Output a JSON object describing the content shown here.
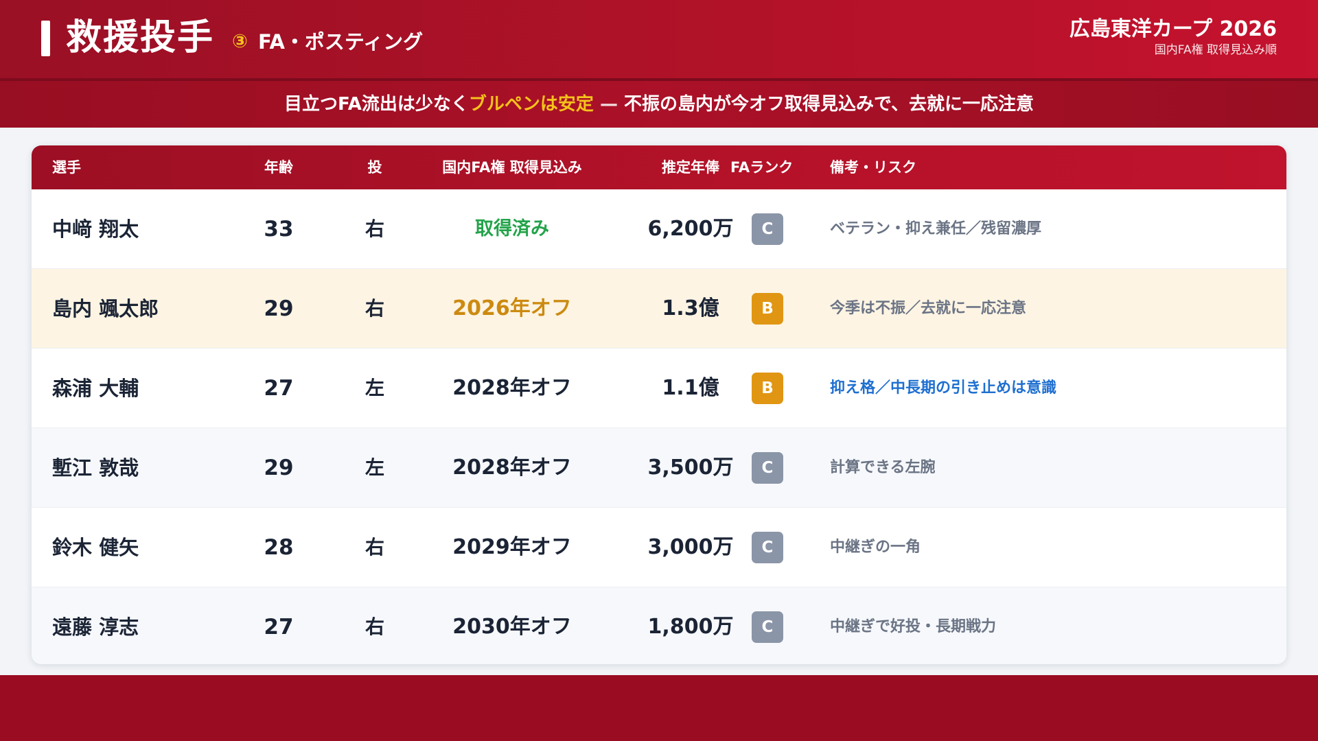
{
  "header": {
    "title": "救援投手",
    "number": "③",
    "subtitle": "FA・ポスティング",
    "team": "広島東洋カープ 2026",
    "team_sub": "国内FA権 取得見込み順"
  },
  "banner": {
    "part1": "目立つFA流出は少なく",
    "highlight": "ブルペンは安定",
    "dash": " — ",
    "part2": "不振の島内が今オフ取得見込みで、去就に一応注意"
  },
  "table": {
    "headers": {
      "player": "選手",
      "age": "年齢",
      "hand": "投",
      "fa": "国内FA権 取得見込み",
      "salary": "推定年俸",
      "rank": "FAランク",
      "notes": "備考・リスク"
    },
    "rows": [
      {
        "name": "中﨑 翔太",
        "age": "33",
        "hand": "右",
        "fa": "取得済み",
        "salary": "6,200万",
        "rank": "C",
        "notes": "ベテラン・抑え兼任／残留濃厚"
      },
      {
        "name": "島内 颯太郎",
        "age": "29",
        "hand": "右",
        "fa": "2026年オフ",
        "salary": "1.3億",
        "rank": "B",
        "notes": "今季は不振／去就に一応注意"
      },
      {
        "name": "森浦 大輔",
        "age": "27",
        "hand": "左",
        "fa": "2028年オフ",
        "salary": "1.1億",
        "rank": "B",
        "notes": "抑え格／中長期の引き止めは意識"
      },
      {
        "name": "塹江 敦哉",
        "age": "29",
        "hand": "左",
        "fa": "2028年オフ",
        "salary": "3,500万",
        "rank": "C",
        "notes": "計算できる左腕"
      },
      {
        "name": "鈴木 健矢",
        "age": "28",
        "hand": "右",
        "fa": "2029年オフ",
        "salary": "3,000万",
        "rank": "C",
        "notes": "中継ぎの一角"
      },
      {
        "name": "遠藤 淳志",
        "age": "27",
        "hand": "右",
        "fa": "2030年オフ",
        "salary": "1,800万",
        "rank": "C",
        "notes": "中継ぎで好投・長期戦力"
      }
    ]
  },
  "colors": {
    "brand_red": "#b11228",
    "highlight_yellow": "#f5c21b",
    "acquired_green": "#23a34a",
    "soon_orange": "#cc8a10",
    "rank_b": "#e09612",
    "rank_c": "#8a95a8",
    "note_blue": "#1e6fd0"
  }
}
